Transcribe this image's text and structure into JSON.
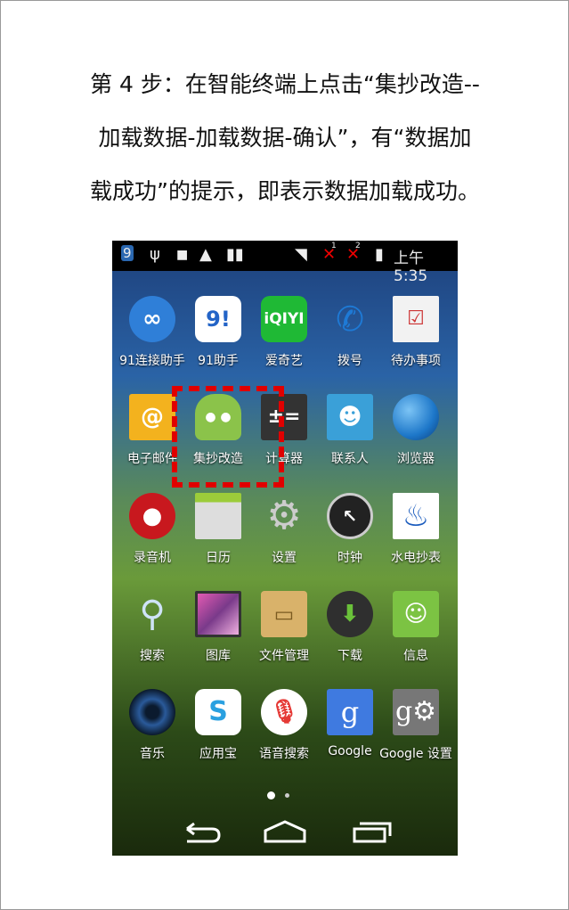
{
  "instruction": {
    "line1": "第 4 步：在智能终端上点击“集抄改造--",
    "line2": "加载数据-加载数据-确认”，有“数据加",
    "line3": "载成功”的提示，即表示数据加载成功。"
  },
  "status_bar": {
    "time": "上午5:35",
    "sim1": "1",
    "sim2": "2"
  },
  "apps": [
    {
      "label": "91连接助手",
      "icon": "91-connect-icon",
      "color": "#2f7fd8"
    },
    {
      "label": "91助手",
      "icon": "91-assistant-icon",
      "color": "#ffffff"
    },
    {
      "label": "爱奇艺",
      "icon": "iqiyi-icon",
      "color": "#1fb935"
    },
    {
      "label": "拨号",
      "icon": "phone-icon",
      "color": "#1e7ad6"
    },
    {
      "label": "待办事项",
      "icon": "todo-icon",
      "color": "#f2f2f2"
    },
    {
      "label": "电子邮件",
      "icon": "email-icon",
      "color": "#f3b21e"
    },
    {
      "label": "集抄改造",
      "icon": "android-icon",
      "color": "#8bc34a"
    },
    {
      "label": "计算器",
      "icon": "calculator-icon",
      "color": "#333333"
    },
    {
      "label": "联系人",
      "icon": "contacts-icon",
      "color": "#3aa0d8"
    },
    {
      "label": "浏览器",
      "icon": "browser-icon",
      "color": "#1d77c9"
    },
    {
      "label": "录音机",
      "icon": "recorder-icon",
      "color": "#c8181e"
    },
    {
      "label": "日历",
      "icon": "calendar-icon",
      "color": "#dddddd"
    },
    {
      "label": "设置",
      "icon": "settings-icon",
      "color": "#9e9e9e"
    },
    {
      "label": "时钟",
      "icon": "clock-icon",
      "color": "#222222"
    },
    {
      "label": "水电抄表",
      "icon": "meter-reading-icon",
      "color": "#1a5bbd"
    },
    {
      "label": "搜索",
      "icon": "search-icon",
      "color": "#8ab0d8"
    },
    {
      "label": "图库",
      "icon": "gallery-icon",
      "color": "#7a3a8a"
    },
    {
      "label": "文件管理",
      "icon": "file-manager-icon",
      "color": "#d9b26a"
    },
    {
      "label": "下载",
      "icon": "download-icon",
      "color": "#2f5a2a"
    },
    {
      "label": "信息",
      "icon": "messaging-icon",
      "color": "#7cc343"
    },
    {
      "label": "音乐",
      "icon": "music-icon",
      "color": "#1a3a6a"
    },
    {
      "label": "应用宝",
      "icon": "app-store-icon",
      "color": "#ffffff"
    },
    {
      "label": "语音搜索",
      "icon": "voice-search-icon",
      "color": "#ffffff"
    },
    {
      "label": "Google",
      "icon": "google-icon",
      "color": "#3f7ae0"
    },
    {
      "label": "Google 设置",
      "icon": "google-settings-icon",
      "color": "#777777"
    }
  ]
}
